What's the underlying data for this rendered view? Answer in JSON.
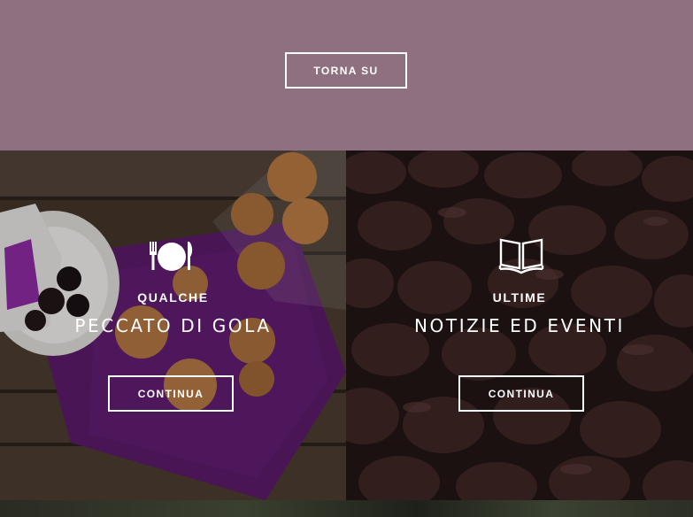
{
  "top_section": {
    "back_to_top_label": "TORNA SU",
    "background_color": "#8f7080"
  },
  "panels": [
    {
      "icon": "cutlery-plate-icon",
      "kicker": "QUALCHE",
      "headline": "PECCATO DI GOLA",
      "button_label": "CONTINUA"
    },
    {
      "icon": "open-book-icon",
      "kicker": "ULTIME",
      "headline": "NOTIZIE ED EVENTI",
      "button_label": "CONTINUA"
    }
  ],
  "colors": {
    "text": "#ffffff",
    "napkin_purple": "#5e1c6c",
    "wood": "#4a3a2e",
    "prune": "#2a1a18"
  }
}
